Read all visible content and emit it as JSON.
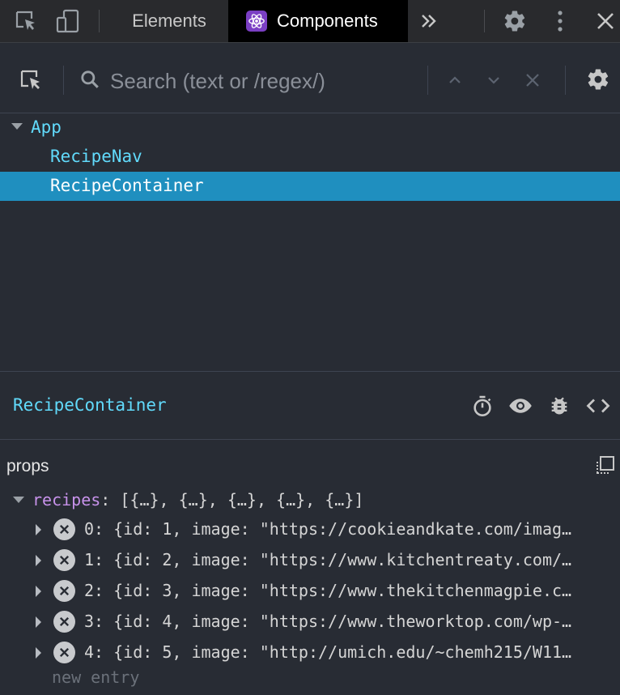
{
  "topbar": {
    "tabs": [
      {
        "label": "Elements",
        "active": false
      },
      {
        "label": "Components",
        "active": true
      }
    ],
    "icons": [
      "inspect-element-icon",
      "device-toggle-icon",
      "more-tabs-icon",
      "settings-gear-icon",
      "kebab-menu-icon",
      "close-icon"
    ]
  },
  "search": {
    "placeholder": "Search (text or /regex/)",
    "value": ""
  },
  "tree": {
    "items": [
      {
        "label": "App",
        "depth": 0,
        "expanded": true,
        "selected": false
      },
      {
        "label": "RecipeNav",
        "depth": 1,
        "selected": false
      },
      {
        "label": "RecipeContainer",
        "depth": 1,
        "selected": true
      }
    ]
  },
  "inspected": {
    "name": "RecipeContainer",
    "icons": [
      "stopwatch-icon",
      "eye-icon",
      "bug-icon",
      "code-icon"
    ]
  },
  "props": {
    "title": "props",
    "recipes_key": "recipes",
    "recipes_summary": "[{…}, {…}, {…}, {…}, {…}]",
    "entries": [
      {
        "index": "0:",
        "value": "{id: 1, image: \"https://cookieandkate.com/imag…"
      },
      {
        "index": "1:",
        "value": "{id: 2, image: \"https://www.kitchentreaty.com/…"
      },
      {
        "index": "2:",
        "value": "{id: 3, image: \"https://www.thekitchenmagpie.c…"
      },
      {
        "index": "3:",
        "value": "{id: 4, image: \"https://www.theworktop.com/wp-…"
      },
      {
        "index": "4:",
        "value": "{id: 5, image: \"http://umich.edu/~chemh215/W11…"
      }
    ],
    "new_entry_placeholder": "new entry"
  },
  "colors": {
    "background": "#282c34",
    "component_name": "#61dafb",
    "selection": "#1f8fbf",
    "prop_key": "#c792ea"
  }
}
